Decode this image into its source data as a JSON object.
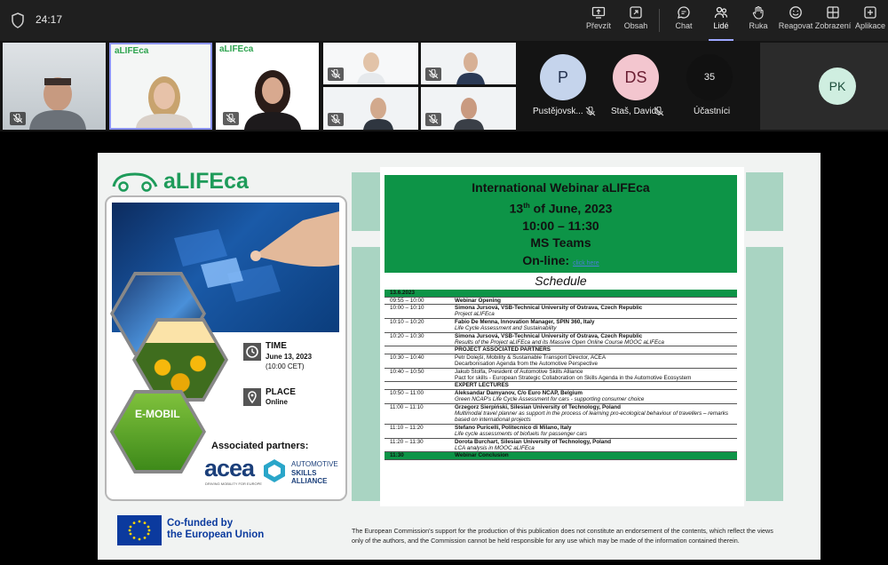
{
  "call": {
    "timer": "24:17",
    "toolbar": [
      {
        "label": "Převzít",
        "icon": "share-screen-icon"
      },
      {
        "label": "Obsah",
        "icon": "share-content-icon"
      },
      {
        "label": "Chat",
        "icon": "chat-icon"
      },
      {
        "label": "Lidé",
        "icon": "people-icon"
      },
      {
        "label": "Ruka",
        "icon": "raise-hand-icon"
      },
      {
        "label": "Reagovat",
        "icon": "react-icon"
      },
      {
        "label": "Zobrazení",
        "icon": "view-icon"
      },
      {
        "label": "Aplikace",
        "icon": "apps-icon"
      }
    ],
    "participants": [
      {
        "initials": "P",
        "name": "Pustějovsk...",
        "color": "#c5d4ec"
      },
      {
        "initials": "DS",
        "name": "Staš, David",
        "color": "#f3c6cf"
      }
    ],
    "overflow_count": "35",
    "overflow_label": "Účastníci",
    "self_initials": "PK",
    "tile_brand": "aLIFEca"
  },
  "slide": {
    "brand": "aLIFEca",
    "time_label": "TIME",
    "time_value": "June 13, 2023",
    "time_sub": "(10:00 CET)",
    "place_label": "PLACE",
    "place_value": "Online",
    "partners_label": "Associated partners:",
    "acea": "acea",
    "acea_tagline": "DRIVING MOBILITY FOR EUROPE",
    "asa_line1": "AUTOMOTIVE",
    "asa_line2": "SKILLS",
    "asa_line3": "ALLIANCE",
    "emobil": "E-MOBIL",
    "eu_line1": "Co-funded by",
    "eu_line2": "the European Union",
    "header": {
      "line1": "International Webinar aLIFEca",
      "line2a": "13",
      "line2sup": "th",
      "line2b": " of June, 2023",
      "line3": "10:00 – 11:30",
      "line4": "MS Teams",
      "line5": "On-line:",
      "link": "click here"
    },
    "schedule_title": "Schedule",
    "disclaimer": "The European Commission's support for the production of this publication does not constitute an endorsement of the contents, which reflect the views only of the authors, and the Commission cannot be held responsible for any use which may be made of the information contained therein."
  },
  "schedule_rows": [
    {
      "time": "13.6.2023",
      "title": "",
      "sub": "",
      "kind": "green"
    },
    {
      "time": "09:55 – 10:00",
      "title": "Webinar Opening",
      "sub": "",
      "kind": "bold"
    },
    {
      "time": "10:00 – 10:10",
      "title": "Simona Jursová, VSB-Technical University of Ostrava, Czech Republic",
      "sub": "Project aLIFEca",
      "kind": "speaker"
    },
    {
      "time": "10:10 – 10:20",
      "title": "Fabio De Menna, Innovation Manager, SPIN 360, Italy",
      "sub": "Life Cycle Assessment and Sustainability",
      "kind": "speaker"
    },
    {
      "time": "10:20 – 10:30",
      "title": "Simona Jursová, VSB-Technical University of Ostrava, Czech Republic",
      "sub": "Results of the Project aLIFEca and its Massive Open Online Course MOOC aLIFEca",
      "kind": "speaker"
    },
    {
      "time": "",
      "title": "PROJECT ASSOCIATED PARTNERS",
      "sub": "",
      "kind": "bold"
    },
    {
      "time": "10:30 – 10:40",
      "title": "Petr Dolejší, Mobility & Sustainable Transport Director, ACEA",
      "sub": "Decarbonisation Agenda from the Automotive Perspective",
      "kind": "plain"
    },
    {
      "time": "10:40 – 10:50",
      "title": "Jakub Štolfa, President of Automotive Skills Alliance",
      "sub": "Pact for skills - European Strategic Collaboration on Skills Agenda in the Automotive Ecosystem",
      "kind": "plain"
    },
    {
      "time": "",
      "title": "EXPERT LECTURES",
      "sub": "",
      "kind": "bold"
    },
    {
      "time": "10:50 – 11:00",
      "title": "Aleksandar Damyanov, C/o Euro NCAP, Belgium",
      "sub": "Green NCAP's Life Cycle Assessment for cars - supporting consumer choice",
      "kind": "speaker"
    },
    {
      "time": "11:00 – 11:10",
      "title": "Grzegorz Sierpiński, Silesian University of Technology, Poland",
      "sub": "Multimodal travel planner as support in the process of learning pro-ecological behaviour of travellers – remarks based on international projects",
      "kind": "speaker"
    },
    {
      "time": "11:10 – 11:20",
      "title": "Stefano Puricelli, Politecnico di Milano, Italy",
      "sub": "Life cycle assessments of biofuels for passenger cars",
      "kind": "speaker"
    },
    {
      "time": "11:20 – 11:30",
      "title": "Dorota Burchart, Silesian University of Technology, Poland",
      "sub": "LCA analysis in MOOC aLIFEca",
      "kind": "speaker"
    },
    {
      "time": "11:30",
      "title": "Webinar Conclusion",
      "sub": "",
      "kind": "green"
    }
  ]
}
